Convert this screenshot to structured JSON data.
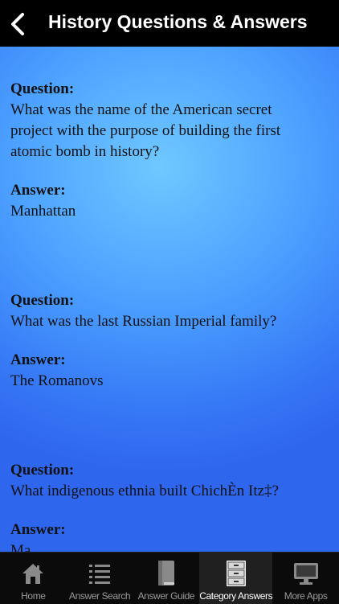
{
  "header": {
    "title": "History Questions & Answers"
  },
  "qa_items": [
    {
      "question_label": "Question:",
      "question_lines": [
        "What was the name of the American secret",
        "project with the purpose of building the first",
        "atomic bomb in history?"
      ],
      "answer_label": "Answer:",
      "answer": "Manhattan"
    },
    {
      "question_label": "Question:",
      "question_lines": [
        "What was the last Russian Imperial family?"
      ],
      "answer_label": "Answer:",
      "answer": "The Romanovs"
    },
    {
      "question_label": "Question:",
      "question_lines": [
        "What indigenous ethnia built ChichÈn Itz‡?"
      ],
      "answer_label": "Answer:",
      "answer": "Ma"
    }
  ],
  "tabs": [
    {
      "label": "Home",
      "icon": "home-icon"
    },
    {
      "label": "Answer Search",
      "icon": "list-icon"
    },
    {
      "label": "Answer Guide",
      "icon": "book-icon"
    },
    {
      "label": "Category Answers",
      "icon": "cabinet-icon",
      "active": true
    },
    {
      "label": "More Apps",
      "icon": "monitor-icon"
    }
  ],
  "colors": {
    "navbar": "#000000",
    "content_light": "#6fc8ff",
    "content_dark": "#2f66ee",
    "tabbar": "#0b0b0b"
  }
}
